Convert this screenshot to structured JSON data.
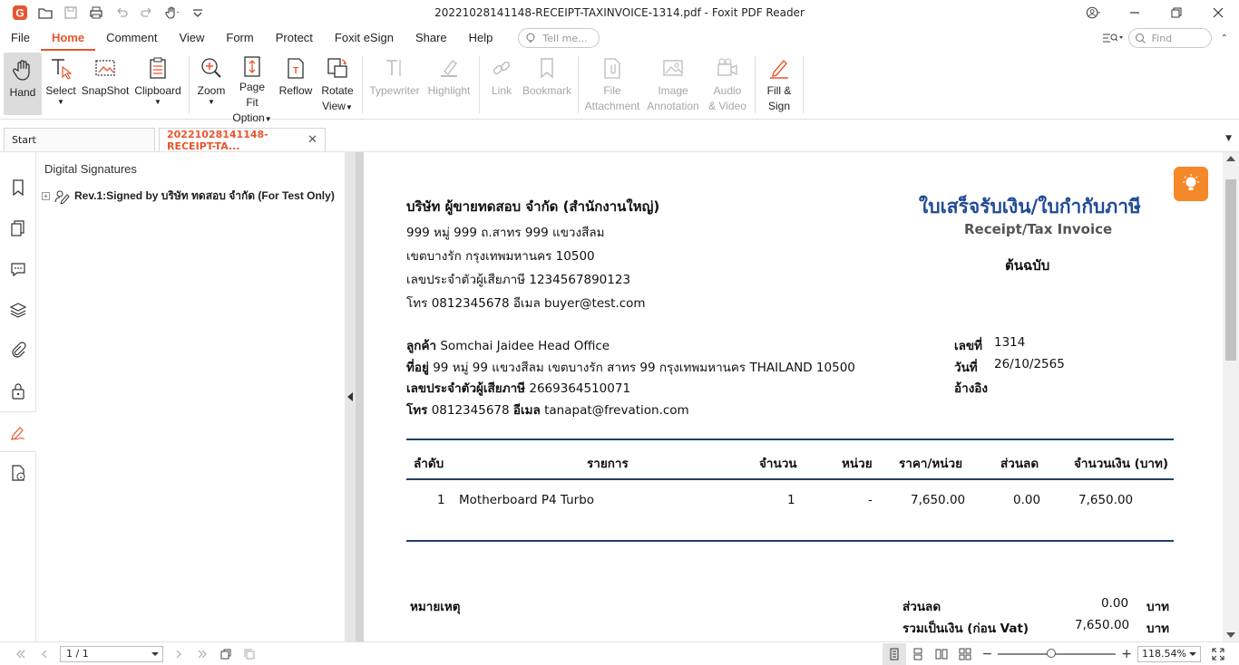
{
  "window": {
    "title": "20221028141148-RECEIPT-TAXINVOICE-1314.pdf - Foxit PDF Reader"
  },
  "menu": {
    "items": [
      "File",
      "Home",
      "Comment",
      "View",
      "Form",
      "Protect",
      "Foxit eSign",
      "Share",
      "Help"
    ],
    "active": "Home",
    "tell_me_placeholder": "Tell me...",
    "find_placeholder": "Find"
  },
  "ribbon": {
    "hand": "Hand",
    "select": "Select",
    "snapshot": "SnapShot",
    "clipboard": "Clipboard",
    "zoom": "Zoom",
    "page_fit_1": "Page Fit",
    "page_fit_2": "Option",
    "reflow": "Reflow",
    "rotate_1": "Rotate",
    "rotate_2": "View",
    "typewriter": "Typewriter",
    "highlight": "Highlight",
    "link": "Link",
    "bookmark": "Bookmark",
    "file_att_1": "File",
    "file_att_2": "Attachment",
    "image_ann_1": "Image",
    "image_ann_2": "Annotation",
    "audio_1": "Audio",
    "audio_2": "& Video",
    "fill_1": "Fill &",
    "fill_2": "Sign"
  },
  "tabs": {
    "start": "Start",
    "doc": "20221028141148-RECEIPT-TA..."
  },
  "side_panel": {
    "title": "Digital Signatures",
    "signature": "Rev.1:Signed by บริษัท ทดสอบ จำกัด (For Test Only)"
  },
  "document": {
    "seller_name": "บริษัท ผู้ขายทดสอบ จำกัด (สำนักงานใหญ่)",
    "seller_addr1": "999 หมู่ 999 ถ.สาทร 999 แขวงสีลม",
    "seller_addr2": "เขตบางรัก  กรุงเทพมหานคร 10500",
    "seller_taxid": "เลขประจำตัวผู้เสียภาษี 1234567890123",
    "seller_contact": "โทร 0812345678  อีเมล buyer@test.com",
    "doc_title_th": "ใบเสร็จรับเงิน/ใบกำกับภาษี",
    "doc_title_en": "Receipt/Tax Invoice",
    "original": "ต้นฉบับ",
    "customer_label": "ลูกค้า",
    "customer_value": "Somchai Jaidee Head Office",
    "address_label": "ที่อยู่",
    "address_value": "99 หมู่ 99 แขวงสีลม เขตบางรัก สาทร 99 กรุงเทพมหานคร THAILAND  10500",
    "taxid_label": "เลขประจำตัวผู้เสียภาษี",
    "taxid_value": "2669364510071",
    "phone_label": "โทร",
    "phone_value": "0812345678",
    "email_label": "อีเมล",
    "email_value": "tanapat@frevation.com",
    "number_label": "เลขที่",
    "number_value": "1314",
    "date_label": "วันที่",
    "date_value": "26/10/2565",
    "ref_label": "อ้างอิง",
    "table_headers": [
      "ลำดับ",
      "รายการ",
      "จำนวน",
      "หน่วย",
      "ราคา/หน่วย",
      "ส่วนลด",
      "จำนวนเงิน (บาท)"
    ],
    "rows": [
      [
        "1",
        "Motherboard P4 Turbo",
        "1",
        "-",
        "7,650.00",
        "0.00",
        "7,650.00"
      ]
    ],
    "note_label": "หมายเหตุ",
    "discount_label": "ส่วนลด",
    "discount_value": "0.00",
    "subtotal_label": "รวมเป็นเงิน (ก่อน Vat)",
    "subtotal_value": "7,650.00",
    "currency": "บาท"
  },
  "status": {
    "page": "1 / 1",
    "zoom": "118.54%",
    "zoom_level": 0.45
  }
}
